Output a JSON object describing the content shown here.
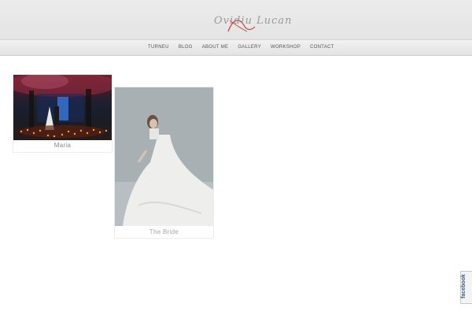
{
  "header": {
    "logo_text": "Ovidiu Lucan"
  },
  "nav": {
    "items": [
      {
        "label": "TURNEU"
      },
      {
        "label": "BLOG"
      },
      {
        "label": "ABOUT ME"
      },
      {
        "label": "GALLERY"
      },
      {
        "label": "WORKSHOP"
      },
      {
        "label": "CONTACT"
      }
    ]
  },
  "gallery": {
    "cards": [
      {
        "title": "Maria"
      },
      {
        "title": "The Bride"
      }
    ]
  },
  "social": {
    "facebook_label": "facebook"
  },
  "colors": {
    "accent": "#c0443a",
    "facebook": "#3b5998"
  }
}
